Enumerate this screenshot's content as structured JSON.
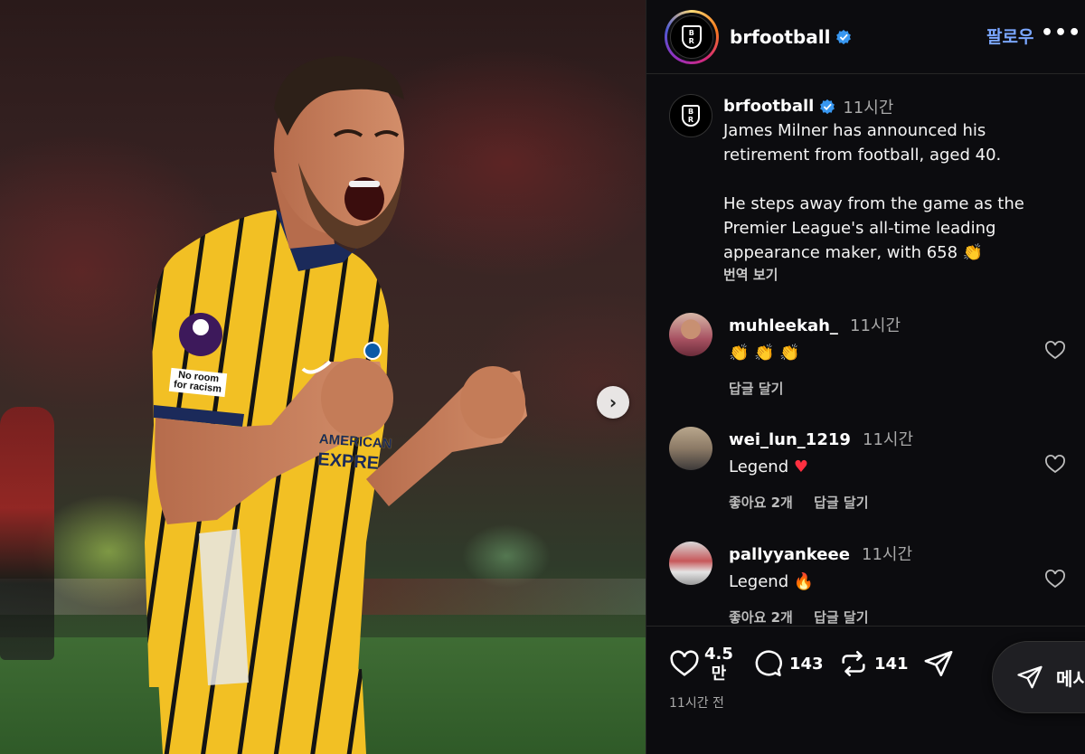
{
  "header": {
    "username": "brfootball",
    "follow_label": "팔로우",
    "more_label": "•••",
    "logo_text_top": "B",
    "logo_text_bottom": "R"
  },
  "post": {
    "username": "brfootball",
    "time": "11시간",
    "caption_line1": "James Milner has announced his",
    "caption_line2": "retirement from football, aged 40.",
    "caption_line3": "He steps away from the game as the",
    "caption_line4": "Premier League's all-time leading",
    "caption_line5": "appearance maker, with 658",
    "caption_emoji": "👏",
    "translate_label": "번역 보기"
  },
  "photo": {
    "sleeve_badge": "No room for racism",
    "sponsor_line1": "AMERICAN",
    "sponsor_line2": "EXPRE"
  },
  "comments": [
    {
      "username": "muhleekah_",
      "time": "11시간",
      "text": "👏 👏 👏",
      "likes": "",
      "reply_label": "답글 달기"
    },
    {
      "username": "wei_lun_1219",
      "time": "11시간",
      "text": "Legend",
      "emoji": "❤️",
      "likes": "좋아요 2개",
      "reply_label": "답글 달기"
    },
    {
      "username": "pallyyankeee",
      "time": "11시간",
      "text": "Legend",
      "emoji": "🔥",
      "likes": "좋아요 2개",
      "reply_label": "답글 달기"
    }
  ],
  "actions": {
    "likes_count_line1": "4.5",
    "likes_count_line2": "만",
    "comments_count": "143",
    "reposts_count": "141",
    "post_time": "11시간 전",
    "message_label": "메시"
  },
  "colors": {
    "accent_blue": "#7aa6ff",
    "heart_red": "#ff3040",
    "jersey_yellow": "#f2c024",
    "background": "#0c0c0f"
  },
  "icons": [
    "verified-icon",
    "next-arrow-icon",
    "heart-icon",
    "comment-icon",
    "repost-icon",
    "share-icon",
    "paper-plane-icon"
  ]
}
